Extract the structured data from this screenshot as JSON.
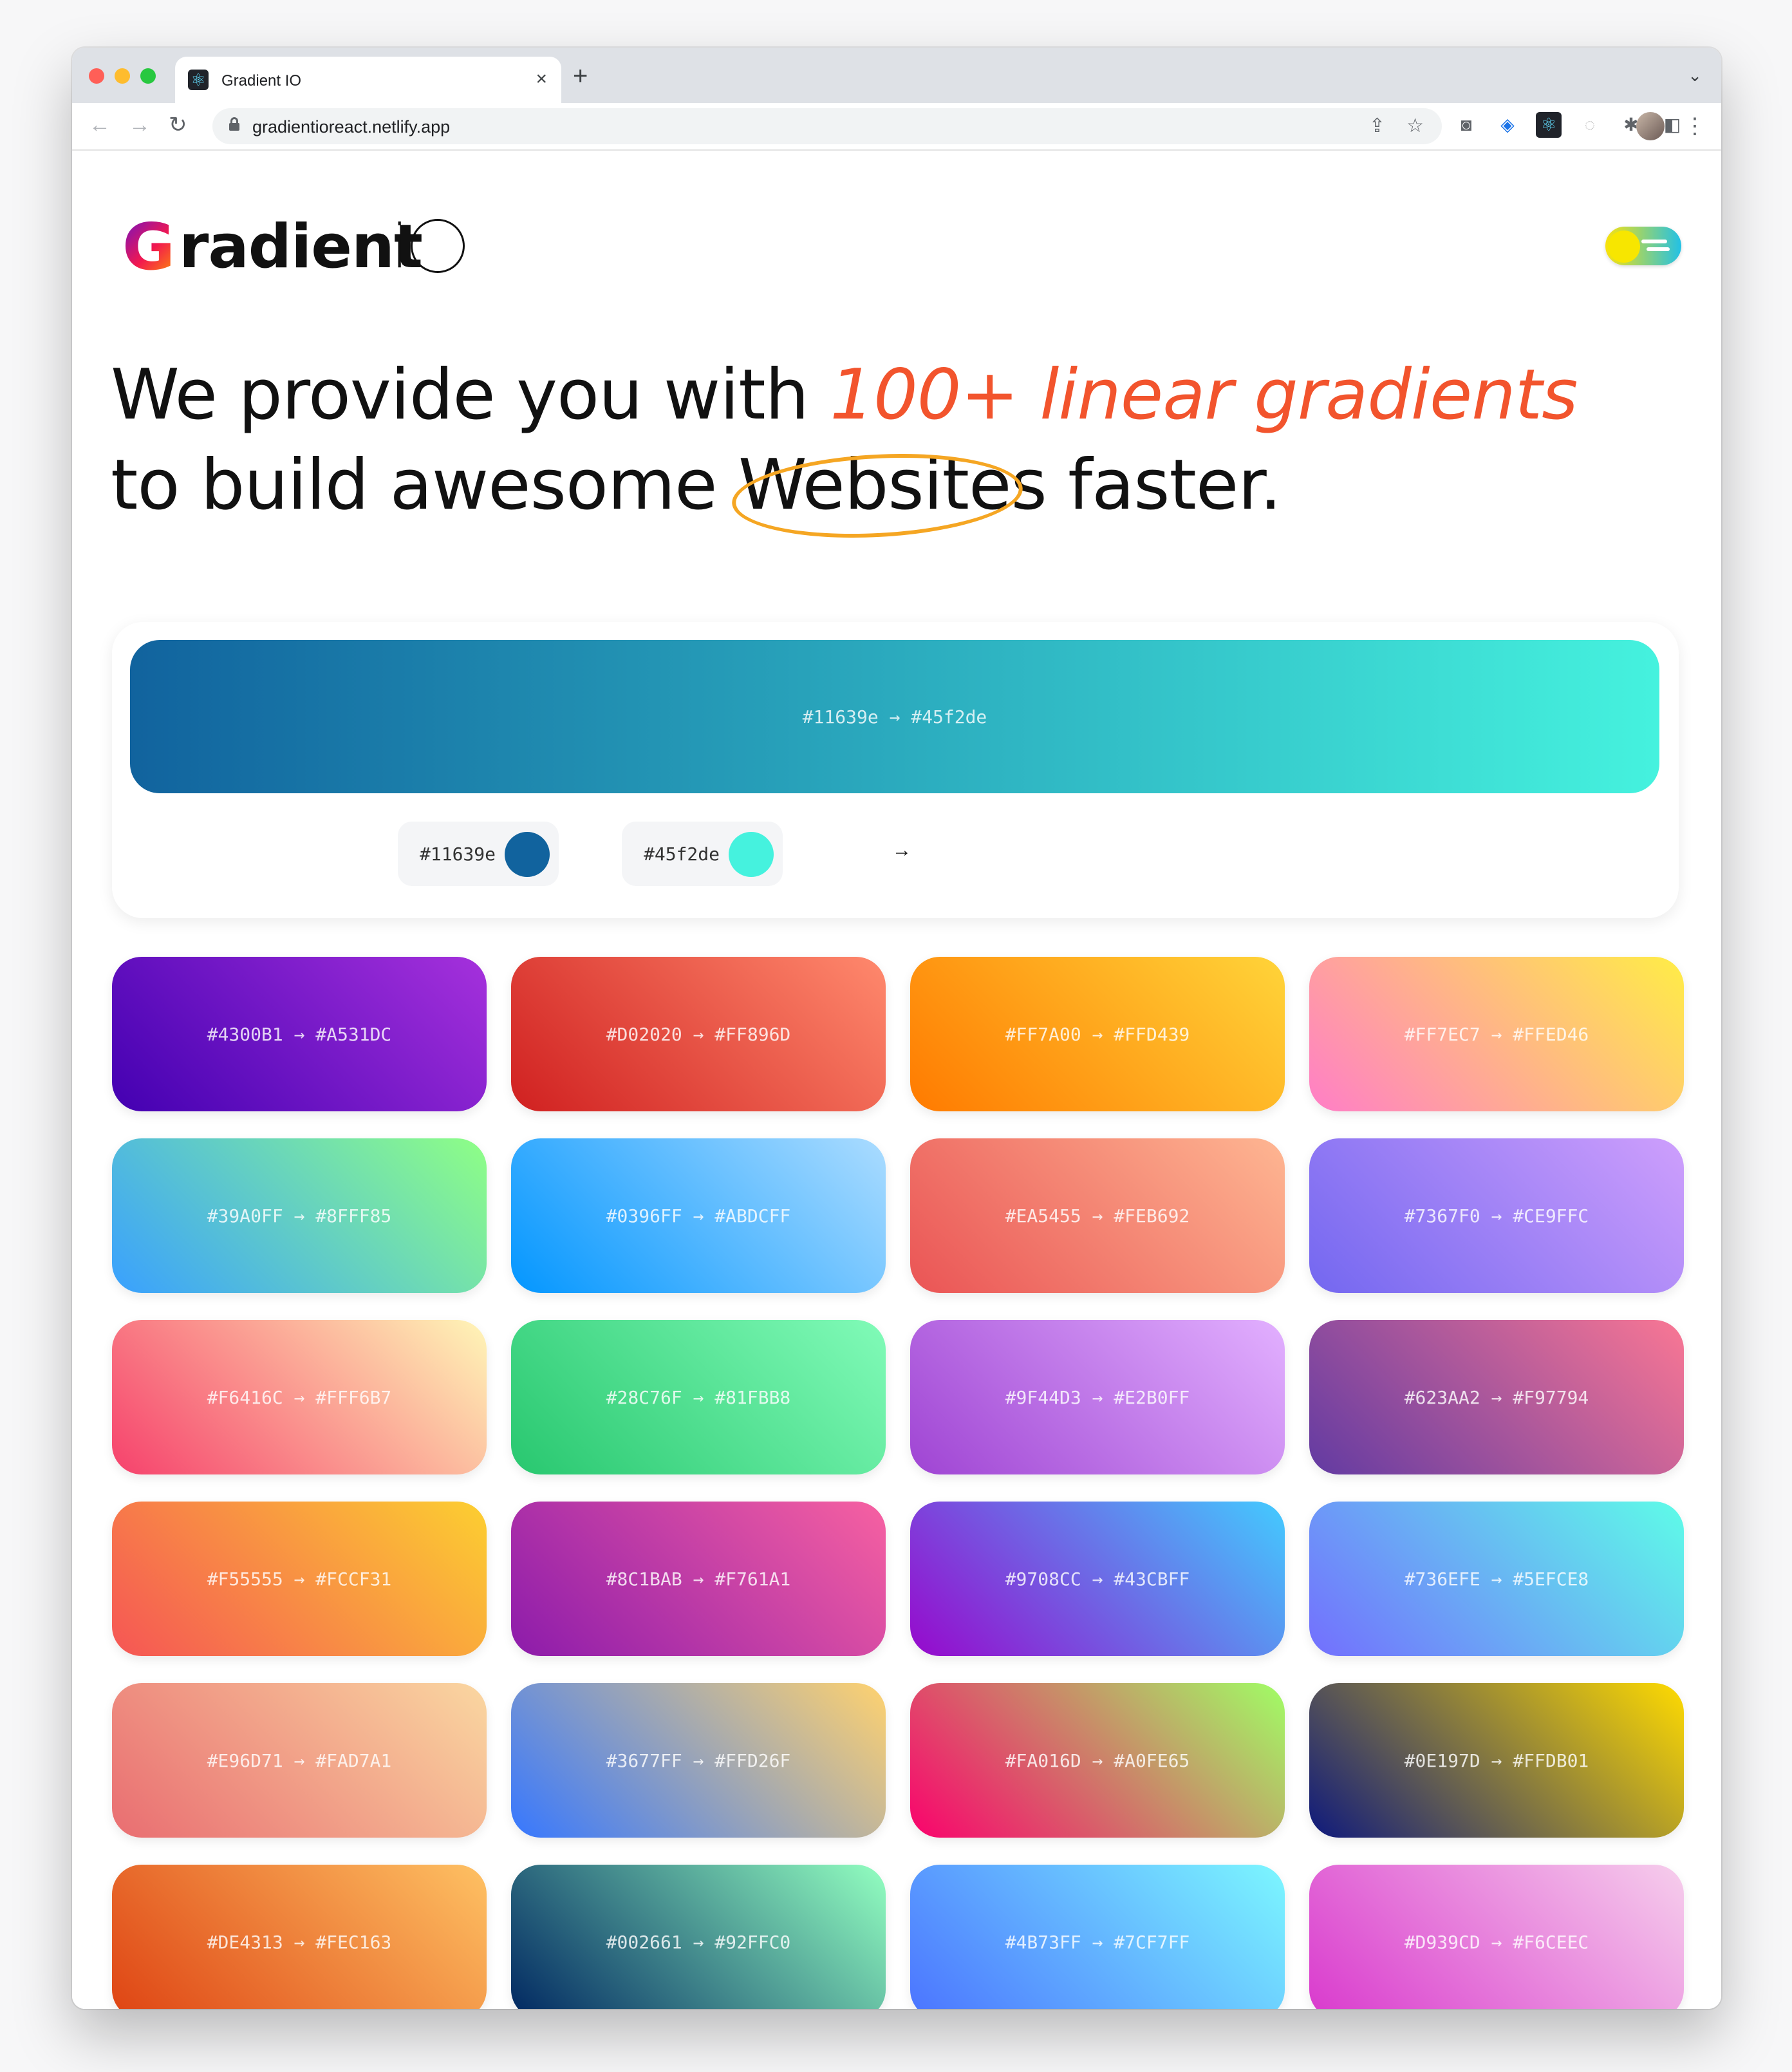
{
  "browser": {
    "tab_title": "Gradient IO",
    "url": "gradientioreact.netlify.app",
    "new_tab_label": "+",
    "close_tab_label": "×"
  },
  "logo": {
    "initial": "G",
    "text": "radient",
    "suffix": "i"
  },
  "headline": {
    "part1": "We provide you with ",
    "accent": "100+ linear gradients",
    "part2": " to build awesome ",
    "circled": "Websites",
    "part3": " faster."
  },
  "featured": {
    "label": "#11639e → #45f2de",
    "from": "#11639e",
    "to": "#45f2de",
    "arrow": "→"
  },
  "gradients": [
    {
      "label": "#4300B1 → #A531DC",
      "from": "#4300B1",
      "to": "#A531DC"
    },
    {
      "label": "#D02020 → #FF896D",
      "from": "#D02020",
      "to": "#FF896D"
    },
    {
      "label": "#FF7A00 → #FFD439",
      "from": "#FF7A00",
      "to": "#FFD439"
    },
    {
      "label": "#FF7EC7 → #FFED46",
      "from": "#FF7EC7",
      "to": "#FFED46"
    },
    {
      "label": "#39A0FF → #8FFF85",
      "from": "#39A0FF",
      "to": "#8FFF85"
    },
    {
      "label": "#0396FF → #ABDCFF",
      "from": "#0396FF",
      "to": "#ABDCFF"
    },
    {
      "label": "#EA5455 → #FEB692",
      "from": "#EA5455",
      "to": "#FEB692"
    },
    {
      "label": "#7367F0 → #CE9FFC",
      "from": "#7367F0",
      "to": "#CE9FFC"
    },
    {
      "label": "#F6416C → #FFF6B7",
      "from": "#F6416C",
      "to": "#FFF6B7"
    },
    {
      "label": "#28C76F → #81FBB8",
      "from": "#28C76F",
      "to": "#81FBB8"
    },
    {
      "label": "#9F44D3 → #E2B0FF",
      "from": "#9F44D3",
      "to": "#E2B0FF"
    },
    {
      "label": "#623AA2 → #F97794",
      "from": "#623AA2",
      "to": "#F97794"
    },
    {
      "label": "#F55555 → #FCCF31",
      "from": "#F55555",
      "to": "#FCCF31"
    },
    {
      "label": "#8C1BAB → #F761A1",
      "from": "#8C1BAB",
      "to": "#F761A1"
    },
    {
      "label": "#9708CC → #43CBFF",
      "from": "#9708CC",
      "to": "#43CBFF"
    },
    {
      "label": "#736EFE → #5EFCE8",
      "from": "#736EFE",
      "to": "#5EFCE8"
    },
    {
      "label": "#E96D71 → #FAD7A1",
      "from": "#E96D71",
      "to": "#FAD7A1"
    },
    {
      "label": "#3677FF → #FFD26F",
      "from": "#3677FF",
      "to": "#FFD26F"
    },
    {
      "label": "#FA016D → #A0FE65",
      "from": "#FA016D",
      "to": "#A0FE65"
    },
    {
      "label": "#0E197D → #FFDB01",
      "from": "#0E197D",
      "to": "#FFDB01"
    },
    {
      "label": "#DE4313 → #FEC163",
      "from": "#DE4313",
      "to": "#FEC163"
    },
    {
      "label": "#002661 → #92FFC0",
      "from": "#002661",
      "to": "#92FFC0"
    },
    {
      "label": "#4B73FF → #7CF7FF",
      "from": "#4B73FF",
      "to": "#7CF7FF"
    },
    {
      "label": "#D939CD → #F6CEEC",
      "from": "#D939CD",
      "to": "#F6CEEC"
    }
  ],
  "icons": [
    "back-icon",
    "forward-icon",
    "reload-icon",
    "lock-icon",
    "share-icon",
    "star-icon",
    "camera-icon",
    "extension-icon",
    "puzzle-icon",
    "sidepanel-icon",
    "menu-icon"
  ]
}
